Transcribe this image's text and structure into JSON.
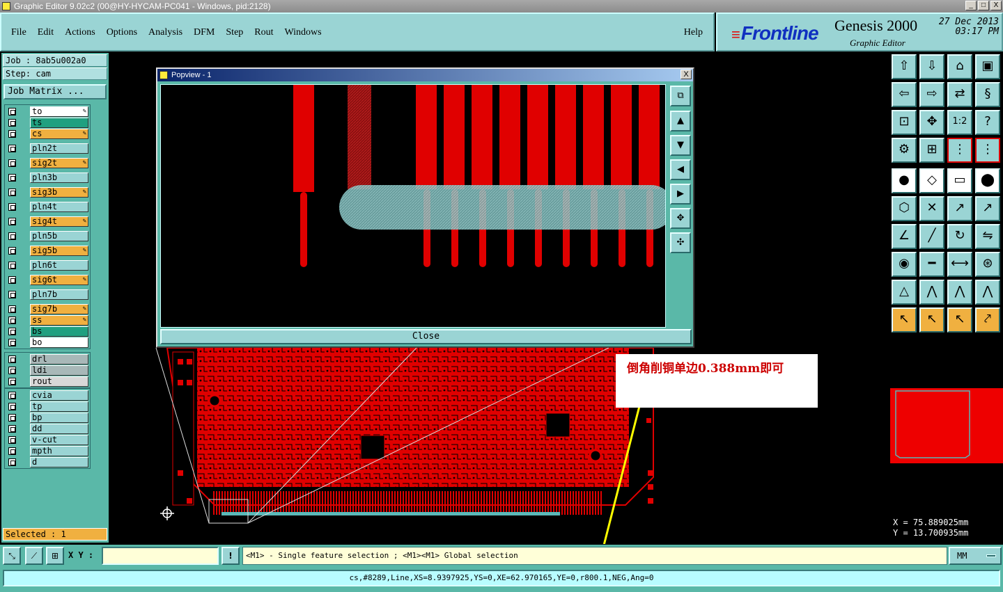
{
  "window": {
    "title": "Graphic Editor 9.02c2 (00@HY-HYCAM-PC041 - Windows, pid:2128)",
    "min": "_",
    "max": "□",
    "close": "X"
  },
  "menu": {
    "items": [
      "File",
      "Edit",
      "Actions",
      "Options",
      "Analysis",
      "DFM",
      "Step",
      "Rout",
      "Windows"
    ],
    "help": "Help"
  },
  "brand": {
    "logo": "Frontline",
    "product": "Genesis 2000",
    "subtitle": "Graphic Editor",
    "date": "27 Dec 2013",
    "time": "03:17 PM"
  },
  "left": {
    "job": "Job : 8ab5u002a0",
    "step": "Step: cam",
    "job_matrix": "Job Matrix ...",
    "selected": "Selected : 1",
    "layers": [
      {
        "name": "to",
        "color": "#ffffff",
        "flag": "✎"
      },
      {
        "name": "ts",
        "color": "#20a080",
        "flag": ""
      },
      {
        "name": "cs",
        "color": "#f0b040",
        "flag": "✎"
      },
      {
        "name": "pln2t",
        "color": "#9ad4d4",
        "flag": ""
      },
      {
        "name": "sig2t",
        "color": "#f0b040",
        "flag": "✎"
      },
      {
        "name": "pln3b",
        "color": "#9ad4d4",
        "flag": ""
      },
      {
        "name": "sig3b",
        "color": "#f0b040",
        "flag": "✎"
      },
      {
        "name": "pln4t",
        "color": "#9ad4d4",
        "flag": ""
      },
      {
        "name": "sig4t",
        "color": "#f0b040",
        "flag": "✎"
      },
      {
        "name": "pln5b",
        "color": "#9ad4d4",
        "flag": ""
      },
      {
        "name": "sig5b",
        "color": "#f0b040",
        "flag": "✎"
      },
      {
        "name": "pln6t",
        "color": "#9ad4d4",
        "flag": ""
      },
      {
        "name": "sig6t",
        "color": "#f0b040",
        "flag": "✎"
      },
      {
        "name": "pln7b",
        "color": "#9ad4d4",
        "flag": ""
      },
      {
        "name": "sig7b",
        "color": "#f0b040",
        "flag": "✎"
      },
      {
        "name": "ss",
        "color": "#f0b040",
        "flag": "✎"
      },
      {
        "name": "bs",
        "color": "#20a080",
        "flag": ""
      },
      {
        "name": "bo",
        "color": "#ffffff",
        "flag": ""
      },
      {
        "name": "drl",
        "color": "#a8b8b8",
        "flag": ""
      },
      {
        "name": "ldi",
        "color": "#a8b8b8",
        "flag": ""
      },
      {
        "name": "rout",
        "color": "#d8d8d8",
        "flag": ""
      },
      {
        "name": "cvia",
        "color": "#9ad4d4",
        "flag": ""
      },
      {
        "name": "tp",
        "color": "#9ad4d4",
        "flag": ""
      },
      {
        "name": "bp",
        "color": "#9ad4d4",
        "flag": ""
      },
      {
        "name": "dd",
        "color": "#9ad4d4",
        "flag": ""
      },
      {
        "name": "v-cut",
        "color": "#9ad4d4",
        "flag": ""
      },
      {
        "name": "mpth",
        "color": "#9ad4d4",
        "flag": ""
      },
      {
        "name": "d",
        "color": "#9ad4d4",
        "flag": ""
      }
    ]
  },
  "popview": {
    "title": "Popview - 1",
    "close_label": "Close"
  },
  "annotation": {
    "text": "倒角削铜单边0.388mm即可"
  },
  "coords": {
    "x": "X  =  75.889025mm",
    "y": "Y  =  13.700935mm"
  },
  "right_tools": {
    "ratio": "1:2",
    "help": "?"
  },
  "bottom": {
    "xy_label": "X Y :",
    "xy_value": "",
    "warn": "!",
    "hint": "<M1> - Single feature selection ; <M1><M1> Global selection",
    "units": "MM",
    "status": "cs,#8289,Line,XS=8.9397925,YS=0,XE=62.970165,YE=0,r800.1,NEG,Ang=0"
  }
}
